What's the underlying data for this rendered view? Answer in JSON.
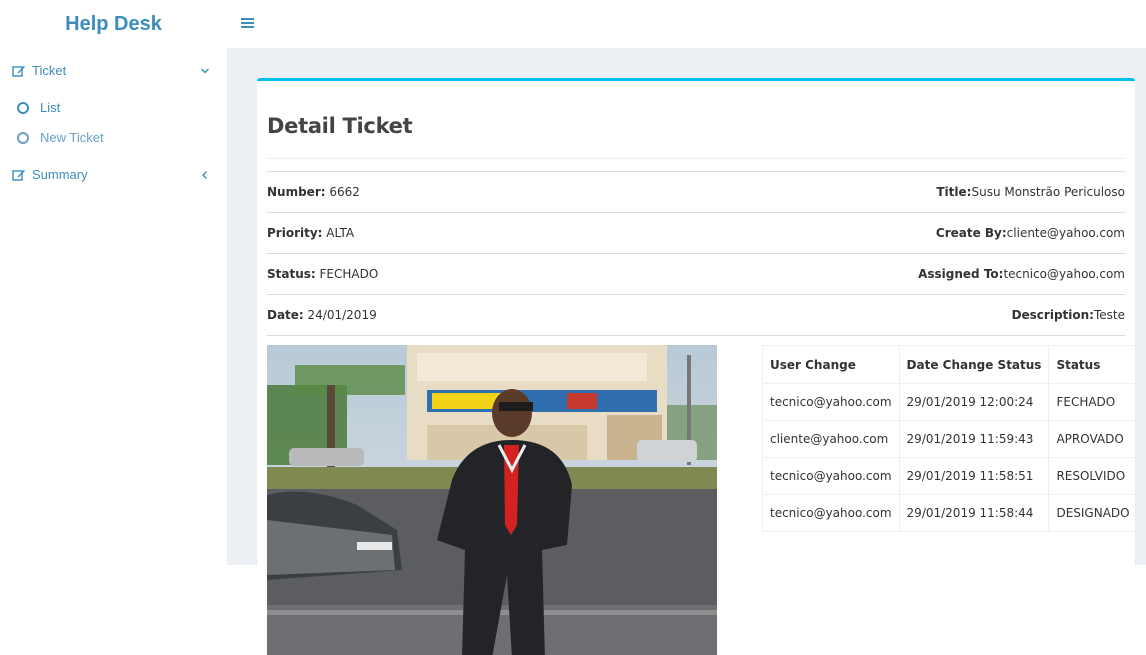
{
  "app": {
    "brand": "Help Desk"
  },
  "sidebar": {
    "items": [
      {
        "label": "Ticket",
        "icon": "edit-icon",
        "caret": "chevron-down-icon"
      },
      {
        "label": "Summary",
        "icon": "edit-icon",
        "caret": "chevron-left-icon"
      }
    ],
    "ticket_sub": [
      {
        "label": "List"
      },
      {
        "label": "New Ticket"
      }
    ]
  },
  "topbar": {
    "menu_icon": "hamburger-icon"
  },
  "page": {
    "title": "Detail Ticket"
  },
  "details": {
    "number_label": "Number:",
    "number_value": " 6662",
    "title_label": "Title:",
    "title_value": "Susu Monstrão Periculoso",
    "priority_label": "Priority:",
    "priority_value": " ALTA",
    "created_label": "Create By:",
    "created_value": "cliente@yahoo.com",
    "status_label": "Status:",
    "status_value": " FECHADO",
    "assigned_label": "Assigned To:",
    "assigned_value": "tecnico@yahoo.com",
    "date_label": "Date:",
    "date_value": " 24/01/2019",
    "description_label": "Description:",
    "description_value": "Teste"
  },
  "history": {
    "headers": [
      "User Change",
      "Date Change Status",
      "Status"
    ],
    "rows": [
      [
        "tecnico@yahoo.com",
        "29/01/2019 12:00:24",
        "FECHADO"
      ],
      [
        "cliente@yahoo.com",
        "29/01/2019 11:59:43",
        "APROVADO"
      ],
      [
        "tecnico@yahoo.com",
        "29/01/2019 11:58:51",
        "RESOLVIDO"
      ],
      [
        "tecnico@yahoo.com",
        "29/01/2019 11:58:44",
        "DESIGNADO"
      ]
    ]
  },
  "colors": {
    "accent": "#3c8dbc",
    "box_top": "#00c0ef",
    "content_bg": "#ecf0f5"
  }
}
